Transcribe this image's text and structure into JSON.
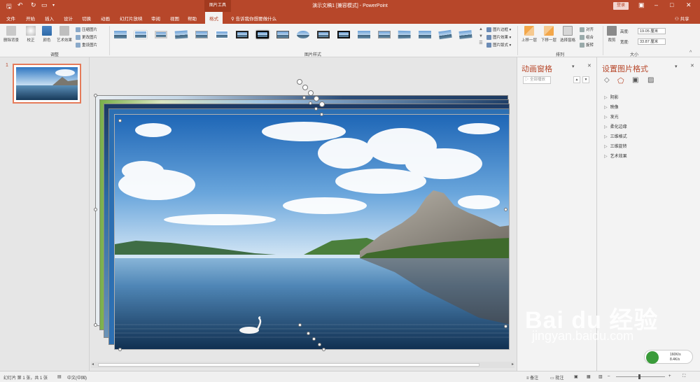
{
  "app": {
    "document_title": "演示文稿1 [兼容模式] - PowerPoint",
    "tools_context": "图片工具",
    "login": "登录",
    "share": "共享"
  },
  "tabs": [
    "文件",
    "开始",
    "插入",
    "设计",
    "切换",
    "动画",
    "幻灯片放映",
    "审阅",
    "视图",
    "帮助",
    "格式"
  ],
  "tell_me": "告诉我你想要做什么",
  "ribbon": {
    "adjust": {
      "remove_bg": "删除背景",
      "correct": "校正",
      "color": "颜色",
      "art_effects": "艺术效果",
      "compress": "压缩图片",
      "change": "更改图片",
      "reset": "重设图片",
      "label": "调整"
    },
    "styles": {
      "label": "图片样式",
      "border": "图片边框",
      "effects": "图片效果",
      "layout": "图片版式"
    },
    "arrange": {
      "bring_forward": "上移一层",
      "send_backward": "下移一层",
      "selection_pane": "选择窗格",
      "align": "对齐",
      "group": "组合",
      "rotate": "旋转",
      "label": "排列"
    },
    "size": {
      "crop": "裁剪",
      "height_label": "高度:",
      "height_value": "19.05 厘米",
      "width_label": "宽度:",
      "width_value": "33.87 厘米",
      "label": "大小"
    }
  },
  "slides": {
    "current_number": "1"
  },
  "animation_pane": {
    "title": "动画窗格",
    "play_all": "全部播放"
  },
  "format_pane": {
    "title": "设置图片格式",
    "items": [
      "阴影",
      "映像",
      "发光",
      "柔化边缘",
      "三维格式",
      "三维旋转",
      "艺术效果"
    ]
  },
  "status": {
    "slide_info": "幻灯片 第 1 张，共 1 张",
    "language": "中文(中国)",
    "notes": "备注",
    "comments": "批注"
  },
  "watermark": {
    "brand": "Bai du 经验",
    "url": "jingyan.baidu.com"
  },
  "net": {
    "up": "160K/s",
    "down": "8.4K/s"
  },
  "colors": {
    "accent": "#b7472a",
    "ribbon_bg": "#f3f3f3",
    "canvas_bg": "#e6e6e6"
  }
}
